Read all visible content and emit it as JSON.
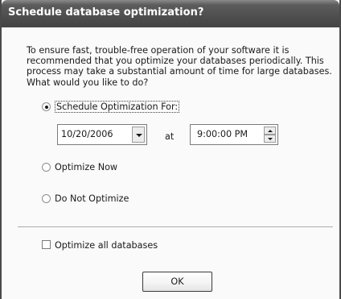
{
  "window": {
    "title": "Schedule database optimization?"
  },
  "intro": {
    "lines": [
      "To ensure fast, trouble-free operation of your software it is",
      "recommended that you optimize your databases periodically. This",
      "process may take a substantial amount of time for large databases.",
      "What would you like to do?"
    ]
  },
  "options": {
    "schedule": {
      "label": "Schedule Optimization For:",
      "selected": true
    },
    "optimize_now": {
      "label": "Optimize Now",
      "selected": false
    },
    "do_not_optimize": {
      "label": "Do Not Optimize",
      "selected": false
    }
  },
  "schedule": {
    "date_value": "10/20/2006",
    "at_label": "at",
    "time_value": "9:00:00 PM"
  },
  "all_databases": {
    "label": "Optimize all databases",
    "checked": false
  },
  "buttons": {
    "ok_label": "OK"
  },
  "icons": {
    "date_dropdown": "chevron-down-icon",
    "time_spin_up": "spin-up-icon",
    "time_spin_down": "spin-down-icon"
  }
}
